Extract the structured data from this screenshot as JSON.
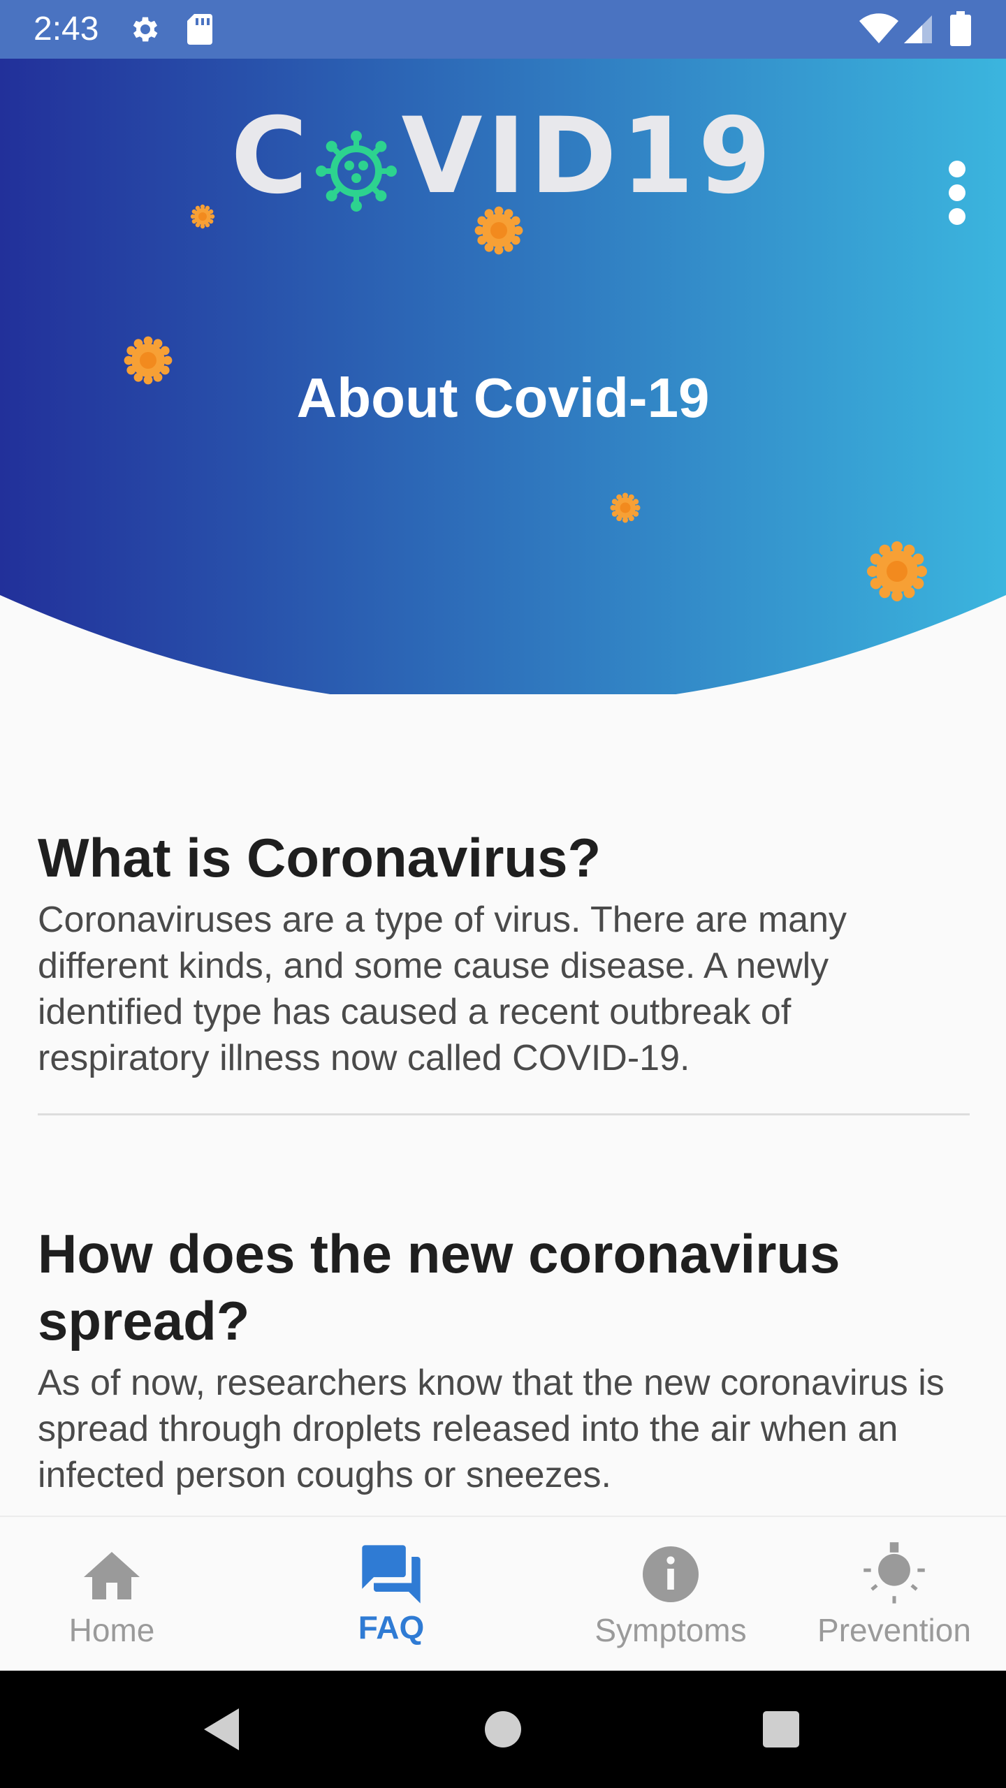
{
  "status_bar": {
    "time": "2:43",
    "icons": [
      "settings-icon",
      "sd-card-icon",
      "wifi-icon",
      "cellular-signal-icon",
      "battery-icon"
    ]
  },
  "header": {
    "logo_text_left": "C",
    "logo_text_right": "VID19",
    "logo_accent_color": "#2dd38f",
    "title": "About Covid-19",
    "gradient_start": "#22309a",
    "gradient_end": "#3bb5de",
    "germ_color": "#f7a035",
    "menu_icon": "more-vert-icon"
  },
  "faq": [
    {
      "question": "What is Coronavirus?",
      "answer": "Coronaviruses are a type of virus. There are many different kinds, and some cause disease. A newly identified type has caused a recent outbreak of respiratory illness now called COVID-19."
    },
    {
      "question": "How does the new coronavirus spread?",
      "answer": "As of now, researchers know that the new coronavirus is spread through droplets released into the air when an infected person coughs or sneezes."
    }
  ],
  "bottom_nav": {
    "active_color": "#2f7bd4",
    "inactive_color": "#9a9a9a",
    "items": [
      {
        "label": "Home",
        "icon": "home-icon",
        "active": false
      },
      {
        "label": "FAQ",
        "icon": "forum-icon",
        "active": true
      },
      {
        "label": "Symptoms",
        "icon": "info-icon",
        "active": false
      },
      {
        "label": "Prevention",
        "icon": "lightbulb-icon",
        "active": false
      }
    ]
  },
  "system_nav": {
    "buttons": [
      "back-icon",
      "home-circle-icon",
      "recents-icon"
    ]
  }
}
